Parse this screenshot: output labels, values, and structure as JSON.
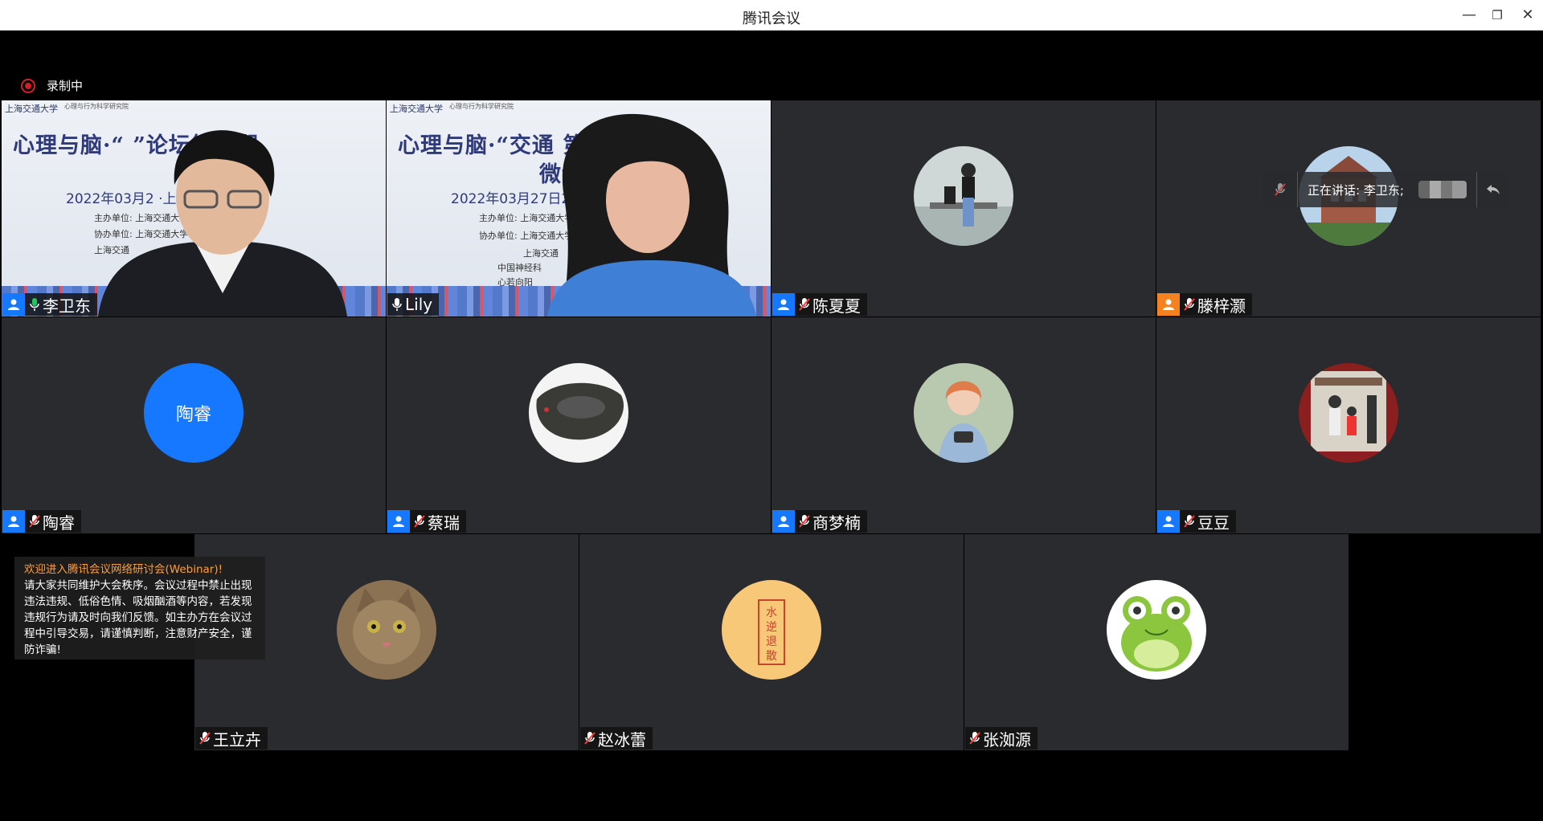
{
  "window": {
    "title": "腾讯会议"
  },
  "recording": {
    "label": "录制中"
  },
  "speaking": {
    "label": "正在讲话: 李卫东;"
  },
  "notice": {
    "heading": "欢迎进入腾讯会议网络研讨会(Webinar)!",
    "body": "请大家共同维护大会秩序。会议过程中禁止出现违法违规、低俗色情、吸烟酗酒等内容，若发现违规行为请及时向我们反馈。如主办方在会议过程中引导交易，请谨慎判断，注意财产安全，谨防诈骗!"
  },
  "slide": {
    "university": "上海交通大学",
    "institute": "心理与行为科学研究院",
    "headline_left": "心理与脑·“   ”论坛第三期",
    "headline_right": "心理与脑·“交通     第三期",
    "subline": "微课",
    "date_left": "2022年03月2       ·上海",
    "date_right": "2022年03月27日20",
    "org1": "主办单位: 上海交通大学",
    "org2": "协办单位: 上海交通大学",
    "org3": "上海交通",
    "org4": "中国神经科",
    "org5": "心若向阳"
  },
  "participants": [
    {
      "name": "李卫东",
      "mic": "on",
      "badge": "blue",
      "video": true
    },
    {
      "name": "Lily",
      "mic": "on",
      "badge": "none",
      "video": true
    },
    {
      "name": "陈夏夏",
      "mic": "off",
      "badge": "blue",
      "avatar": "photo"
    },
    {
      "name": "滕梓灏",
      "mic": "off",
      "badge": "orange",
      "avatar": "photo"
    },
    {
      "name": "陶睿",
      "mic": "off",
      "badge": "blue",
      "avatar": "text",
      "avatar_text": "陶睿"
    },
    {
      "name": "蔡瑞",
      "mic": "off",
      "badge": "blue",
      "avatar": "photo"
    },
    {
      "name": "商梦楠",
      "mic": "off",
      "badge": "blue",
      "avatar": "photo"
    },
    {
      "name": "豆豆",
      "mic": "off",
      "badge": "blue",
      "avatar": "photo"
    },
    {
      "name": "王立卉",
      "mic": "off",
      "badge": "none",
      "avatar": "photo"
    },
    {
      "name": "赵冰蕾",
      "mic": "off",
      "badge": "none",
      "avatar": "photo"
    },
    {
      "name": "张洳源",
      "mic": "off",
      "badge": "none",
      "avatar": "photo"
    }
  ],
  "colors": {
    "accent": "#1677ff",
    "active_border": "#22b14c",
    "record": "#d11f2a",
    "notice_head": "#ff9d3a"
  }
}
